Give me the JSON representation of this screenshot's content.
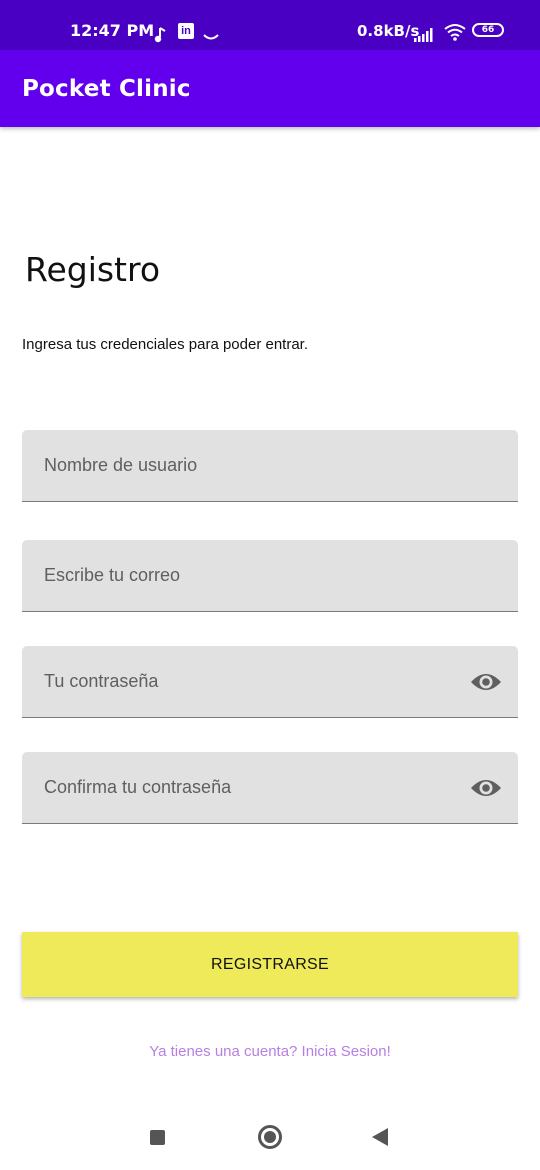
{
  "status_bar": {
    "time": "12:47 PM",
    "linkedin_label": "in",
    "speed": "0.8kB/s",
    "battery": "66",
    "background": "#4a00c2"
  },
  "app_bar": {
    "title": "Pocket Clinic",
    "color": "#6200ee"
  },
  "form": {
    "title": "Registro",
    "subtitle": "Ingresa tus credenciales para poder entrar.",
    "username_placeholder": "Nombre de usuario",
    "email_placeholder": "Escribe tu correo",
    "password_placeholder": "Tu contraseña",
    "confirm_password_placeholder": "Confirma tu contraseña",
    "register_label": "REGISTRARSE",
    "register_color": "#eeea5a",
    "login_link": "Ya tienes una cuenta? Inicia Sesion!",
    "link_color": "#b77fe3"
  },
  "icons": {
    "password_toggle": "eye-icon",
    "confirm_password_toggle": "eye-icon",
    "nav_recents": "square-icon",
    "nav_home": "circle-icon",
    "nav_back": "triangle-back-icon"
  }
}
